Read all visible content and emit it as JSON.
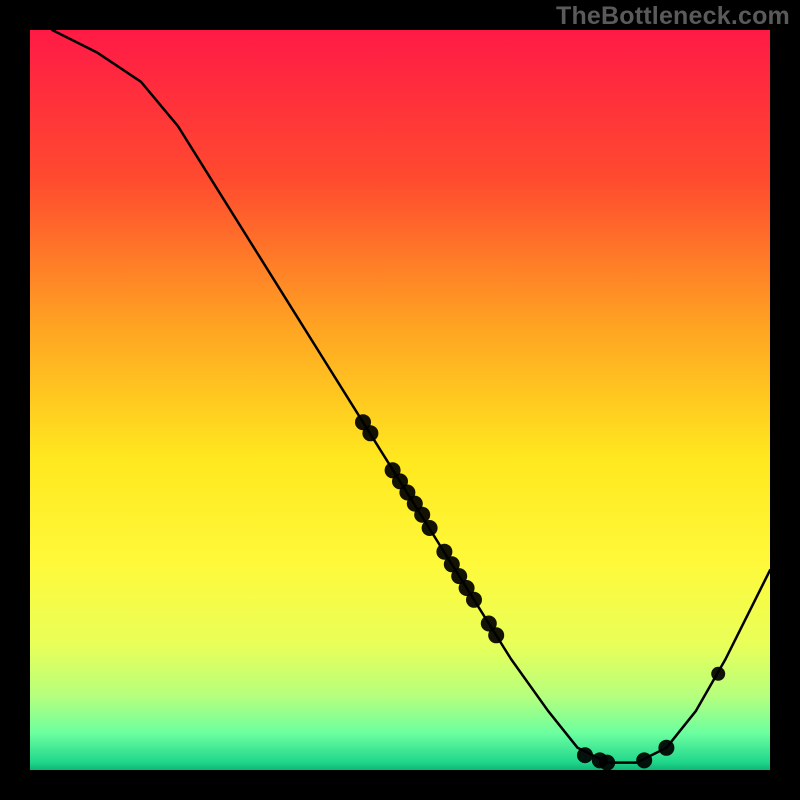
{
  "watermark": "TheBottleneck.com",
  "chart_data": {
    "type": "line",
    "title": "",
    "xlabel": "",
    "ylabel": "",
    "xlim": [
      0,
      100
    ],
    "ylim": [
      0,
      100
    ],
    "curve": [
      {
        "x": 3,
        "y": 100
      },
      {
        "x": 9,
        "y": 97
      },
      {
        "x": 15,
        "y": 93
      },
      {
        "x": 20,
        "y": 87
      },
      {
        "x": 25,
        "y": 79
      },
      {
        "x": 30,
        "y": 71
      },
      {
        "x": 35,
        "y": 63
      },
      {
        "x": 40,
        "y": 55
      },
      {
        "x": 45,
        "y": 47
      },
      {
        "x": 50,
        "y": 39
      },
      {
        "x": 55,
        "y": 31
      },
      {
        "x": 60,
        "y": 23
      },
      {
        "x": 65,
        "y": 15
      },
      {
        "x": 70,
        "y": 8
      },
      {
        "x": 74,
        "y": 3
      },
      {
        "x": 78,
        "y": 1
      },
      {
        "x": 82,
        "y": 1
      },
      {
        "x": 86,
        "y": 3
      },
      {
        "x": 90,
        "y": 8
      },
      {
        "x": 94,
        "y": 15
      },
      {
        "x": 98,
        "y": 23
      },
      {
        "x": 100,
        "y": 27
      }
    ],
    "markers_curve": [
      {
        "x": 45,
        "y": 47
      },
      {
        "x": 46,
        "y": 45.5
      },
      {
        "x": 49,
        "y": 40.5
      },
      {
        "x": 50,
        "y": 39
      },
      {
        "x": 51,
        "y": 37.5
      },
      {
        "x": 52,
        "y": 36
      },
      {
        "x": 53,
        "y": 34.5
      },
      {
        "x": 54,
        "y": 32.7
      },
      {
        "x": 56,
        "y": 29.5
      },
      {
        "x": 57,
        "y": 27.8
      },
      {
        "x": 58,
        "y": 26.2
      },
      {
        "x": 59,
        "y": 24.6
      },
      {
        "x": 60,
        "y": 23
      },
      {
        "x": 62,
        "y": 19.8
      },
      {
        "x": 63,
        "y": 18.2
      }
    ],
    "markers_valley": [
      {
        "x": 75,
        "y": 2
      },
      {
        "x": 77,
        "y": 1.3
      },
      {
        "x": 78,
        "y": 1
      },
      {
        "x": 83,
        "y": 1.3
      },
      {
        "x": 86,
        "y": 3
      }
    ],
    "markers_right": [
      {
        "x": 93,
        "y": 13
      }
    ],
    "gradient_stops": [
      {
        "offset": 0.0,
        "color": "#ff1a46"
      },
      {
        "offset": 0.2,
        "color": "#ff4a2f"
      },
      {
        "offset": 0.4,
        "color": "#ffa322"
      },
      {
        "offset": 0.58,
        "color": "#ffe81f"
      },
      {
        "offset": 0.72,
        "color": "#fff93a"
      },
      {
        "offset": 0.83,
        "color": "#e9ff59"
      },
      {
        "offset": 0.9,
        "color": "#b6ff7d"
      },
      {
        "offset": 0.95,
        "color": "#6cffa0"
      },
      {
        "offset": 0.99,
        "color": "#1fd68b"
      },
      {
        "offset": 1.0,
        "color": "#0fb574"
      }
    ]
  }
}
